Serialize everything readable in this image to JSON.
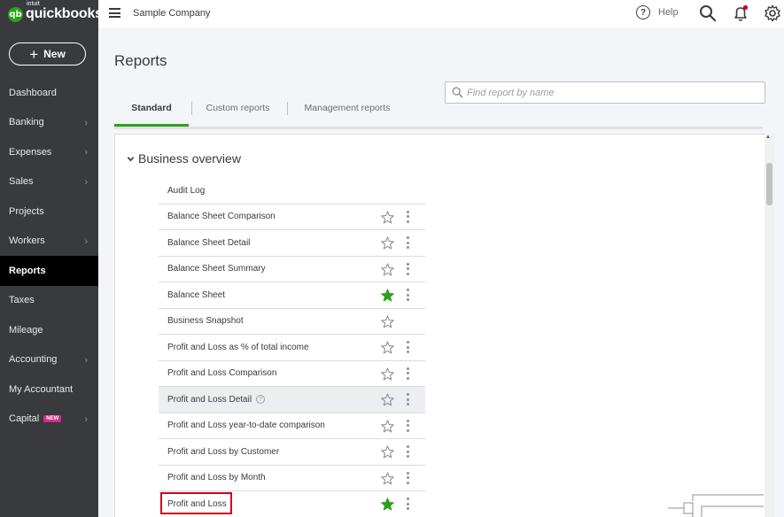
{
  "app": {
    "logo_mark": "qb",
    "logo_small": "intuit",
    "logo_name": "quickbooks",
    "company_name": "Sample Company"
  },
  "sidebar": {
    "new_label": "New",
    "items": [
      {
        "label": "Dashboard",
        "chevron": false
      },
      {
        "label": "Banking",
        "chevron": true
      },
      {
        "label": "Expenses",
        "chevron": true
      },
      {
        "label": "Sales",
        "chevron": true
      },
      {
        "label": "Projects",
        "chevron": false
      },
      {
        "label": "Workers",
        "chevron": true
      },
      {
        "label": "Reports",
        "chevron": false,
        "active": true
      },
      {
        "label": "Taxes",
        "chevron": false
      },
      {
        "label": "Mileage",
        "chevron": false
      },
      {
        "label": "Accounting",
        "chevron": true
      },
      {
        "label": "My Accountant",
        "chevron": false
      },
      {
        "label": "Capital",
        "chevron": true,
        "badge": "NEW"
      }
    ]
  },
  "header": {
    "help_label": "Help",
    "help_icon": "?"
  },
  "main": {
    "title": "Reports",
    "search_placeholder": "Find report by name",
    "tabs": [
      "Standard",
      "Custom reports",
      "Management reports"
    ],
    "active_tab": "Standard"
  },
  "section": {
    "title": "Business overview",
    "reports": [
      {
        "name": "Audit Log",
        "favorite": null,
        "menu": false
      },
      {
        "name": "Balance Sheet Comparison",
        "favorite": false,
        "menu": true
      },
      {
        "name": "Balance Sheet Detail",
        "favorite": false,
        "menu": true
      },
      {
        "name": "Balance Sheet Summary",
        "favorite": false,
        "menu": true
      },
      {
        "name": "Balance Sheet",
        "favorite": true,
        "menu": true
      },
      {
        "name": "Business Snapshot",
        "favorite": false,
        "menu": false
      },
      {
        "name": "Profit and Loss as % of total income",
        "favorite": false,
        "menu": true
      },
      {
        "name": "Profit and Loss Comparison",
        "favorite": false,
        "menu": true
      },
      {
        "name": "Profit and Loss Detail",
        "favorite": false,
        "menu": true,
        "help": true,
        "hover": true
      },
      {
        "name": "Profit and Loss year-to-date comparison",
        "favorite": false,
        "menu": true
      },
      {
        "name": "Profit and Loss by Customer",
        "favorite": false,
        "menu": true
      },
      {
        "name": "Profit and Loss by Month",
        "favorite": false,
        "menu": true
      },
      {
        "name": "Profit and Loss",
        "favorite": true,
        "menu": true,
        "highlighted": true
      }
    ]
  },
  "colors": {
    "brand_green": "#2ca01c",
    "sidebar_bg": "#393a3d",
    "highlight_red": "#d0021b",
    "badge_pink": "#d52b8a"
  }
}
